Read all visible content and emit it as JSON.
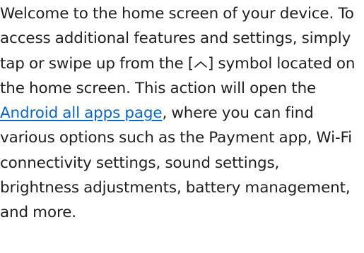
{
  "paragraph": {
    "part1": "Welcome to the home screen of your device. To access additional features and settings, simply tap or swipe up from the ",
    "bracket_open": "[",
    "symbol_icon": "chevron-up-icon",
    "bracket_close": "]",
    "part2": " symbol located on the home screen. This action will open the",
    "link_text": " Android all apps page",
    "part3": ", where you can find various options such as the Payment app, Wi-Fi connectivity settings, sound settings, brightness adjustments, battery management, and more."
  },
  "colors": {
    "text": "#1f1f1f",
    "link": "#0b66c2"
  }
}
